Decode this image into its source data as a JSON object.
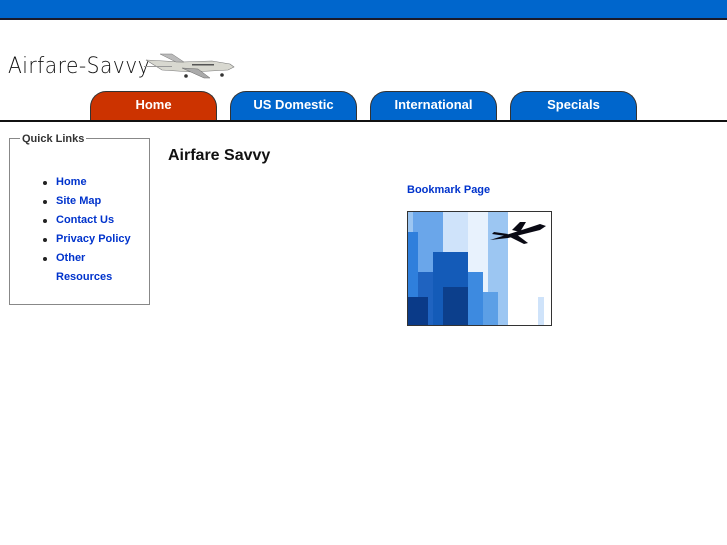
{
  "site": {
    "logo_text": "Airfare-Savvy",
    "brand_color": "#0066cc",
    "active_tab_color": "#cc3300"
  },
  "nav": {
    "tabs": [
      {
        "label": "Home",
        "active": true
      },
      {
        "label": "US Domestic",
        "active": false
      },
      {
        "label": "International",
        "active": false
      },
      {
        "label": "Specials",
        "active": false
      }
    ]
  },
  "quick_links": {
    "title": "Quick Links",
    "items": [
      {
        "label": "Home"
      },
      {
        "label": "Site Map"
      },
      {
        "label": "Contact Us"
      },
      {
        "label": "Privacy Policy"
      },
      {
        "label": "Other Resources"
      }
    ]
  },
  "main": {
    "title": "Airfare Savvy",
    "bookmark_label": "Bookmark Page",
    "image_icon": "city-skyline-airplane-image"
  }
}
